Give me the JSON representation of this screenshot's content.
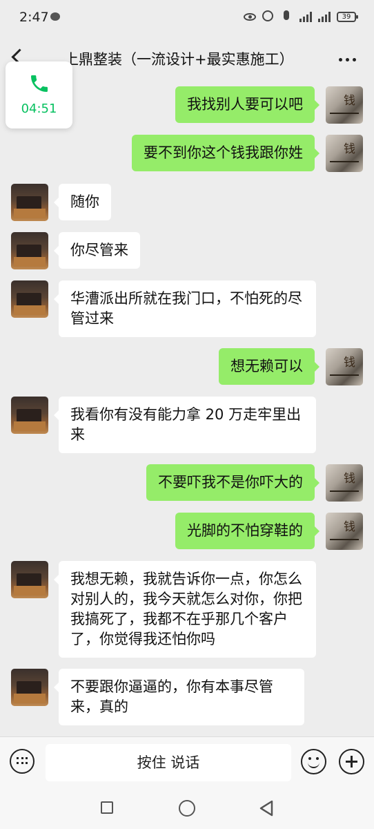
{
  "status_bar": {
    "time": "2:47",
    "battery": "39"
  },
  "header": {
    "title": "上鼎整装（一流设计+最实惠施工）"
  },
  "call": {
    "duration": "04:51",
    "accent": "#07c160"
  },
  "colors": {
    "sent_bubble": "#95ec69",
    "received_bubble": "#ffffff",
    "background": "#ededed"
  },
  "messages": [
    {
      "side": "right",
      "text": "我找别人要可以吧"
    },
    {
      "side": "right",
      "text": "要不到你这个钱我跟你姓"
    },
    {
      "side": "left",
      "text": "随你"
    },
    {
      "side": "left",
      "text": "你尽管来"
    },
    {
      "side": "left",
      "text": "华漕派出所就在我门口，不怕死的尽管过来"
    },
    {
      "side": "right",
      "text": "想无赖可以"
    },
    {
      "side": "left",
      "text": "我看你有没有能力拿 20 万走牢里出来"
    },
    {
      "side": "right",
      "text": "不要吓我不是你吓大的"
    },
    {
      "side": "right",
      "text": "光脚的不怕穿鞋的"
    },
    {
      "side": "left",
      "text": "我想无赖，我就告诉你一点，你怎么对别人的，我今天就怎么对你，你把我搞死了，我都不在乎那几个客户了，你觉得我还怕你吗"
    },
    {
      "side": "left",
      "text": "不要跟你逼逼的，你有本事尽管来，真的"
    }
  ],
  "input": {
    "voice_label": "按住 说话"
  },
  "icons": {
    "back": "back-arrow-icon",
    "more": "more-icon",
    "call": "phone-icon",
    "keyboard": "keyboard-icon",
    "emoji": "emoji-icon",
    "plus": "plus-icon"
  }
}
